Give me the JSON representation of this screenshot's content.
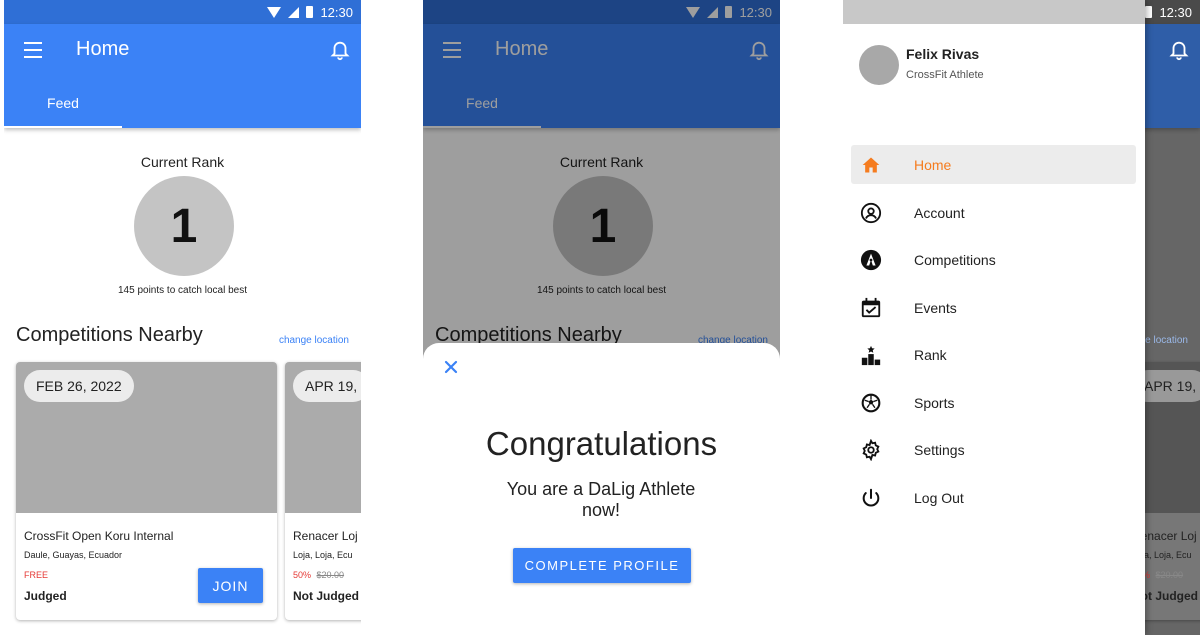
{
  "status_bar": {
    "time": "12:30"
  },
  "app_bar": {
    "title": "Home",
    "tab_feed": "Feed"
  },
  "feed": {
    "rank_title": "Current Rank",
    "rank_value": "1",
    "rank_points": "145 points to catch local best",
    "section_title": "Competitions Nearby",
    "change_location": "change location",
    "cards": [
      {
        "date": "FEB 26, 2022",
        "name": "CrossFit Open Koru Internal",
        "location": "Daule, Guayas, Ecuador",
        "price": "FREE",
        "price_old": "",
        "judging": "Judged",
        "join_label": "JOIN"
      },
      {
        "date": "APR 19,",
        "name": "Renacer Loj",
        "location": "Loja, Loja, Ecu",
        "price": "50%",
        "price_old": "$20.00",
        "judging": "Not Judged"
      }
    ]
  },
  "modal": {
    "title": "Congratulations",
    "subtitle": "You are a DaLig Athlete now!",
    "button_label": "COMPLETE PROFILE"
  },
  "drawer": {
    "user_name": "Felix Rivas",
    "user_role": "CrossFit Athlete",
    "items": [
      {
        "label": "Home",
        "icon": "home-icon"
      },
      {
        "label": "Account",
        "icon": "account-icon"
      },
      {
        "label": "Competitions",
        "icon": "competitions-icon"
      },
      {
        "label": "Events",
        "icon": "calendar-icon"
      },
      {
        "label": "Rank",
        "icon": "podium-icon"
      },
      {
        "label": "Sports",
        "icon": "ball-icon"
      },
      {
        "label": "Settings",
        "icon": "gear-icon"
      },
      {
        "label": "Log Out",
        "icon": "power-icon"
      }
    ]
  },
  "colors": {
    "primary": "#3b82f6",
    "accent": "#f57c1f",
    "price_red": "#e53935"
  }
}
